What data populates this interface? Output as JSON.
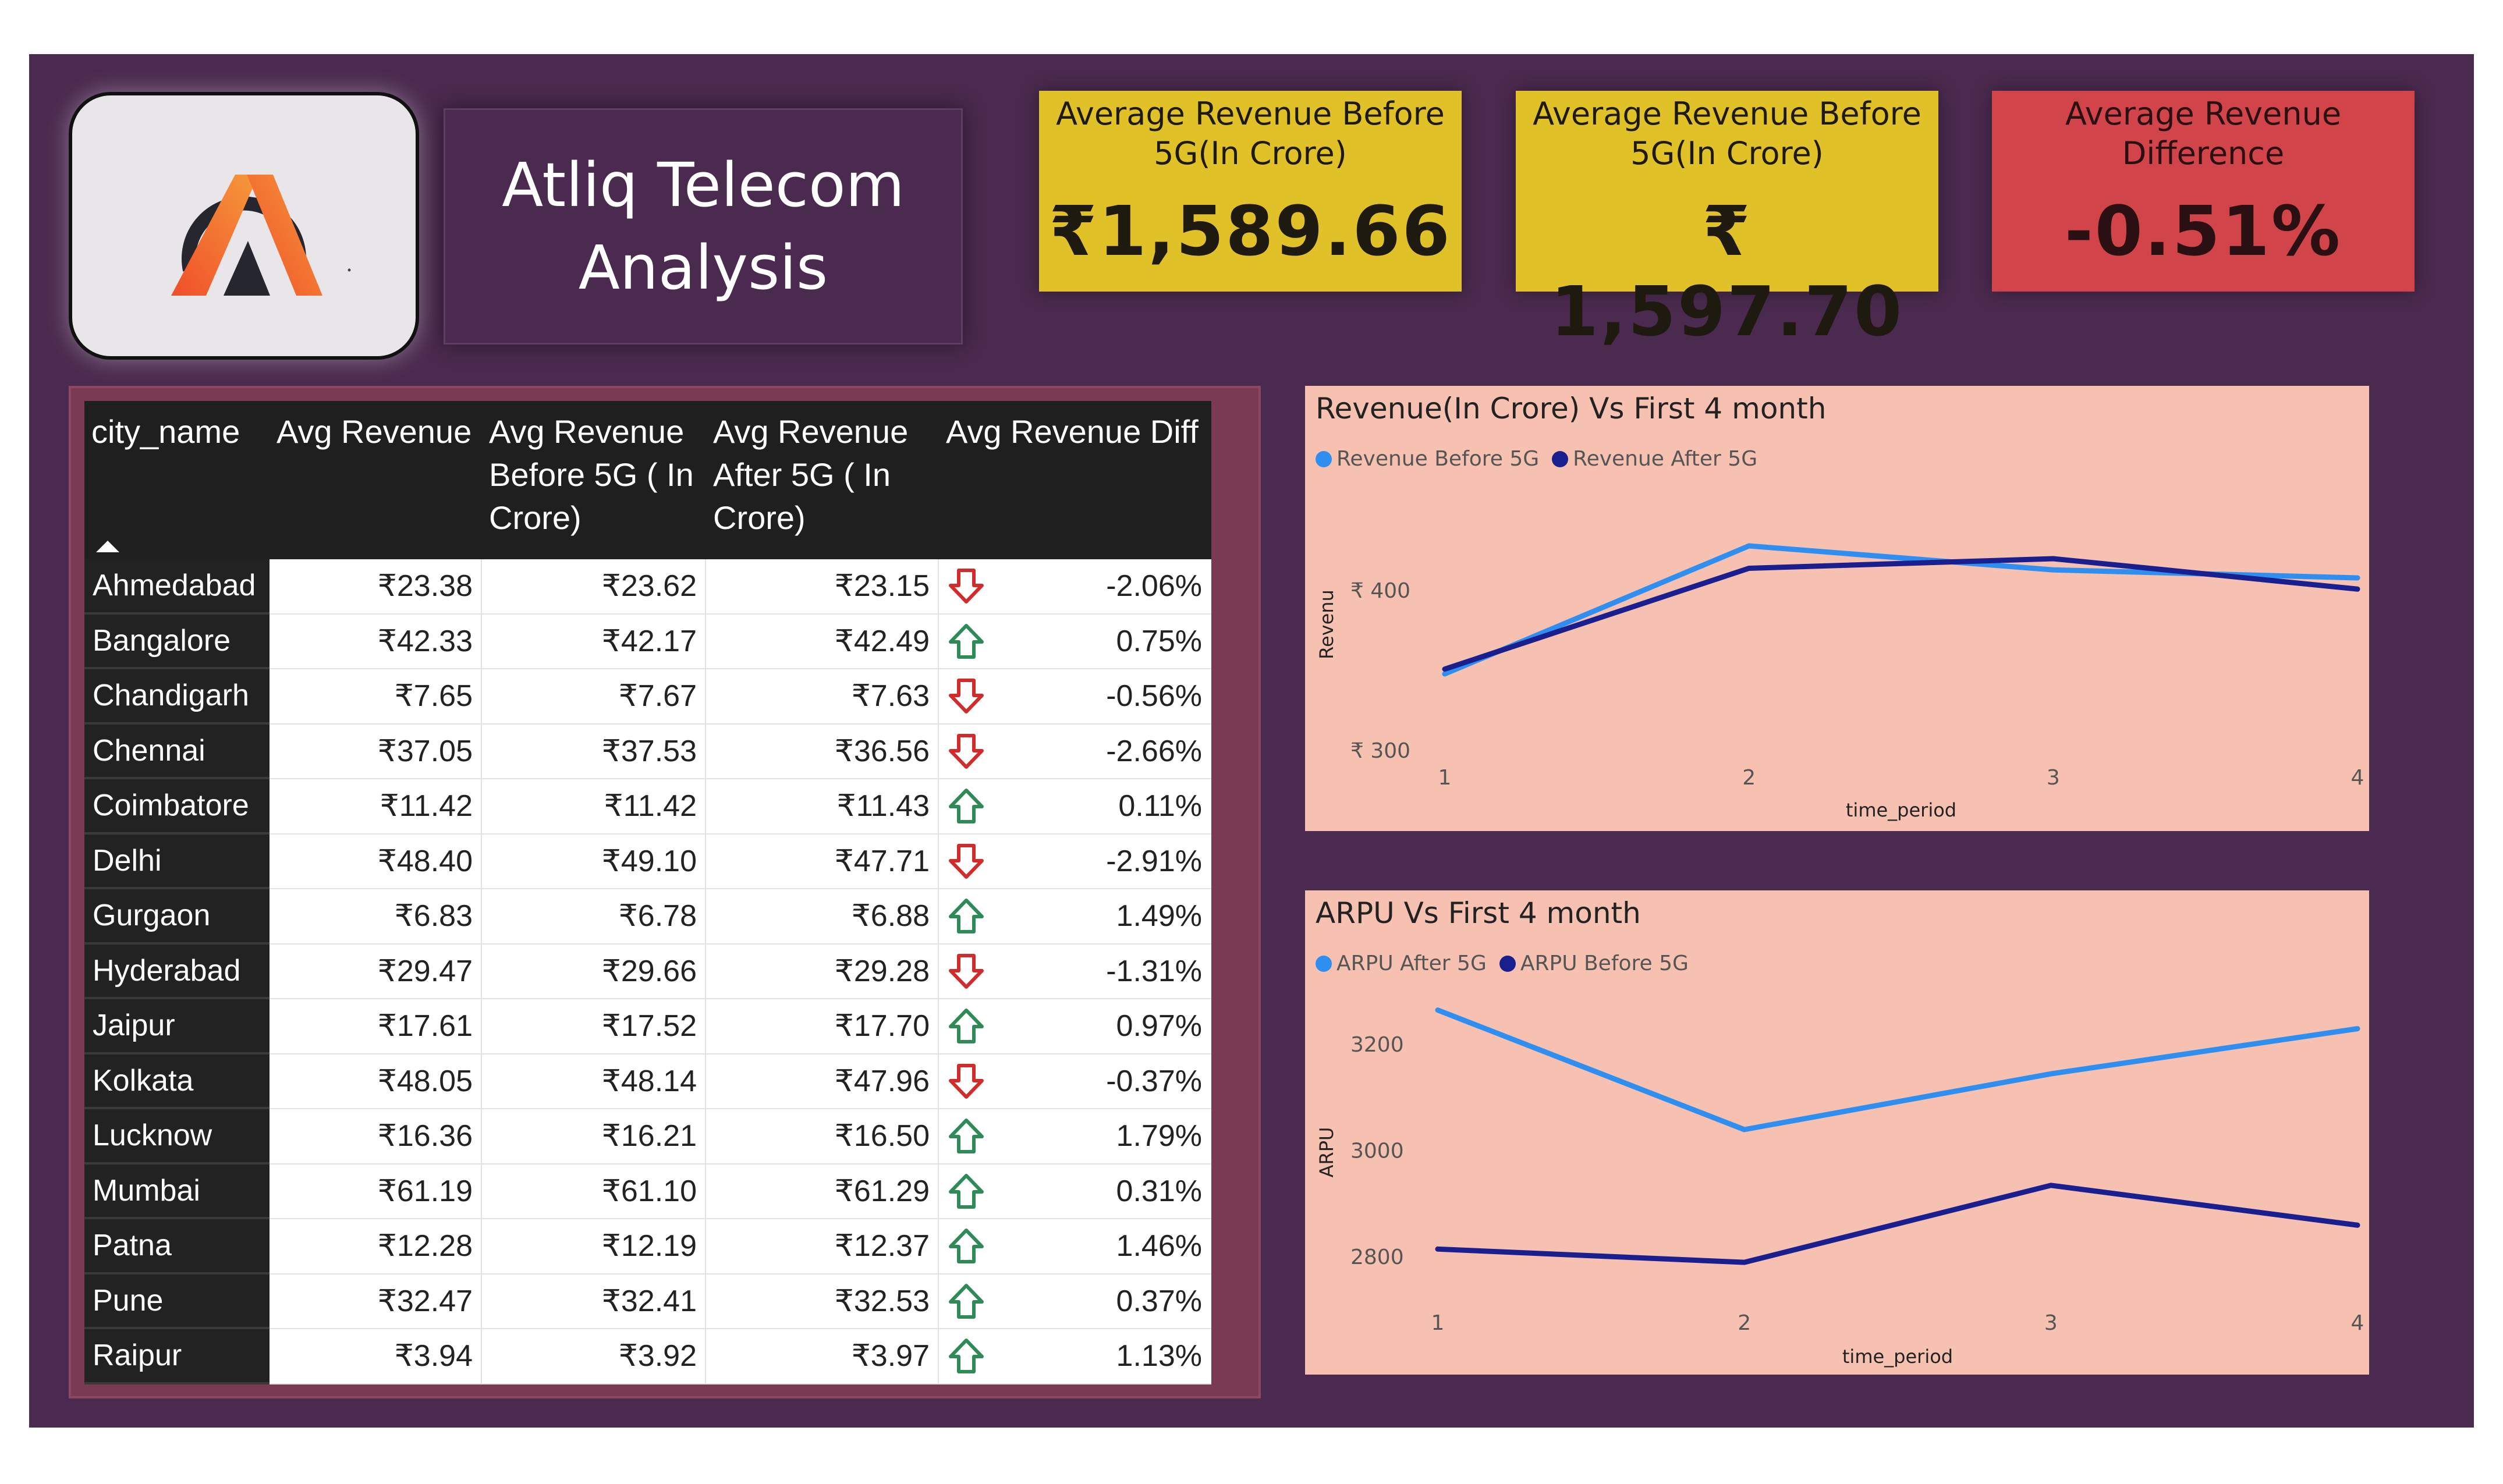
{
  "header": {
    "title": "Atliq Telecom\nAnalysis"
  },
  "kpis": [
    {
      "label": "Average Revenue Before\n5G(In Crore)",
      "value": "₹1,589.66",
      "color": "#e0c128"
    },
    {
      "label": "Average Revenue Before\n5G(In Crore)",
      "value": "₹ 1,597.70",
      "color": "#e0c128"
    },
    {
      "label": "Average Revenue\nDifference",
      "value": "-0.51%",
      "color": "#d14449"
    }
  ],
  "table": {
    "headers": [
      "city_name",
      "Avg Revenue",
      "Avg Revenue\nBefore 5G ( In\nCrore)",
      "Avg Revenue\nAfter 5G ( In\nCrore)",
      "Avg Revenue Diff"
    ],
    "rows": [
      {
        "city": "Ahmedabad",
        "avg": "₹23.38",
        "before": "₹23.62",
        "after": "₹23.15",
        "dir": "down",
        "diff": "-2.06%"
      },
      {
        "city": "Bangalore",
        "avg": "₹42.33",
        "before": "₹42.17",
        "after": "₹42.49",
        "dir": "up",
        "diff": "0.75%"
      },
      {
        "city": "Chandigarh",
        "avg": "₹7.65",
        "before": "₹7.67",
        "after": "₹7.63",
        "dir": "down",
        "diff": "-0.56%"
      },
      {
        "city": "Chennai",
        "avg": "₹37.05",
        "before": "₹37.53",
        "after": "₹36.56",
        "dir": "down",
        "diff": "-2.66%"
      },
      {
        "city": "Coimbatore",
        "avg": "₹11.42",
        "before": "₹11.42",
        "after": "₹11.43",
        "dir": "up",
        "diff": "0.11%"
      },
      {
        "city": "Delhi",
        "avg": "₹48.40",
        "before": "₹49.10",
        "after": "₹47.71",
        "dir": "down",
        "diff": "-2.91%"
      },
      {
        "city": "Gurgaon",
        "avg": "₹6.83",
        "before": "₹6.78",
        "after": "₹6.88",
        "dir": "up",
        "diff": "1.49%"
      },
      {
        "city": "Hyderabad",
        "avg": "₹29.47",
        "before": "₹29.66",
        "after": "₹29.28",
        "dir": "down",
        "diff": "-1.31%"
      },
      {
        "city": "Jaipur",
        "avg": "₹17.61",
        "before": "₹17.52",
        "after": "₹17.70",
        "dir": "up",
        "diff": "0.97%"
      },
      {
        "city": "Kolkata",
        "avg": "₹48.05",
        "before": "₹48.14",
        "after": "₹47.96",
        "dir": "down",
        "diff": "-0.37%"
      },
      {
        "city": "Lucknow",
        "avg": "₹16.36",
        "before": "₹16.21",
        "after": "₹16.50",
        "dir": "up",
        "diff": "1.79%"
      },
      {
        "city": "Mumbai",
        "avg": "₹61.19",
        "before": "₹61.10",
        "after": "₹61.29",
        "dir": "up",
        "diff": "0.31%"
      },
      {
        "city": "Patna",
        "avg": "₹12.28",
        "before": "₹12.19",
        "after": "₹12.37",
        "dir": "up",
        "diff": "1.46%"
      },
      {
        "city": "Pune",
        "avg": "₹32.47",
        "before": "₹32.41",
        "after": "₹32.53",
        "dir": "up",
        "diff": "0.37%"
      },
      {
        "city": "Raipur",
        "avg": "₹3.94",
        "before": "₹3.92",
        "after": "₹3.97",
        "dir": "up",
        "diff": "1.13%"
      }
    ],
    "up_color": "#2e8b57",
    "down_color": "#d22b2b"
  },
  "chart_data": [
    {
      "type": "line",
      "title": "Revenue(In Crore) Vs First 4 month",
      "xlabel": "time_period",
      "ylabel": "Revenu",
      "x": [
        1,
        2,
        3,
        4
      ],
      "y_ticks": [
        "₹ 300",
        "₹ 400"
      ],
      "ylim": [
        300,
        420
      ],
      "series": [
        {
          "name": "Revenue Before 5G",
          "color": "#2f8ff0",
          "values": [
            348,
            428,
            413,
            408
          ]
        },
        {
          "name": "Revenue After 5G",
          "color": "#1a1f8f",
          "values": [
            351,
            414,
            420,
            401
          ]
        }
      ]
    },
    {
      "type": "line",
      "title": "ARPU Vs First 4 month",
      "xlabel": "time_period",
      "ylabel": "ARPU",
      "x": [
        1,
        2,
        3,
        4
      ],
      "y_ticks": [
        "2800",
        "3000",
        "3200"
      ],
      "ylim": [
        2800,
        3200
      ],
      "series": [
        {
          "name": "ARPU After 5G",
          "color": "#2f8ff0",
          "values": [
            3265,
            3040,
            3145,
            3230
          ]
        },
        {
          "name": "ARPU Before 5G",
          "color": "#1a1f8f",
          "values": [
            2815,
            2790,
            2935,
            2860
          ]
        }
      ]
    }
  ]
}
